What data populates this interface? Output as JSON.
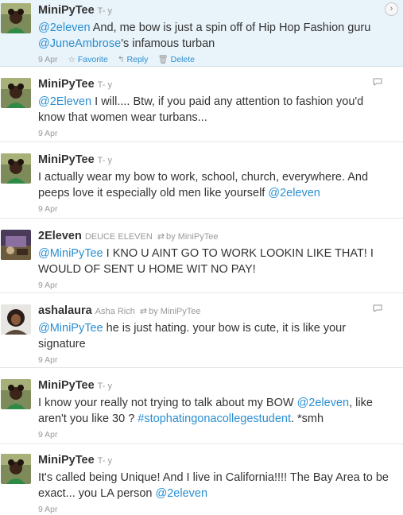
{
  "tweets": [
    {
      "screen_name": "MiniPyTee",
      "full_name": "T- y",
      "text_parts": [
        {
          "t": "@2eleven",
          "k": "mention"
        },
        {
          "t": " And, me bow is just a spin off of Hip Hop Fashion guru ",
          "k": "plain"
        },
        {
          "t": "@JuneAmbrose",
          "k": "mention"
        },
        {
          "t": "'s infamous turban",
          "k": "plain"
        }
      ],
      "date": "9 Apr",
      "actions": {
        "favorite": "Favorite",
        "reply": "Reply",
        "delete": "Delete"
      },
      "expand": "›"
    },
    {
      "screen_name": "MiniPyTee",
      "full_name": "T- y",
      "text_parts": [
        {
          "t": "@2Eleven",
          "k": "mention"
        },
        {
          "t": " I will.... Btw, if you paid any attention to fashion you'd know that women wear turbans...",
          "k": "plain"
        }
      ],
      "date": "9 Apr"
    },
    {
      "screen_name": "MiniPyTee",
      "full_name": "T- y",
      "text_parts": [
        {
          "t": "I actually wear my bow to work, school, church, everywhere. And peeps love it especially old men like yourself ",
          "k": "plain"
        },
        {
          "t": "@2eleven",
          "k": "mention"
        }
      ],
      "date": "9 Apr"
    },
    {
      "screen_name": "2Eleven",
      "full_name": "DEUCE ELEVEN",
      "retweeted_by": "by MiniPyTee",
      "text_parts": [
        {
          "t": "@MiniPyTee",
          "k": "mention"
        },
        {
          "t": " I KNO U AINT GO TO WORK LOOKIN LIKE THAT! I WOULD OF SENT U HOME WIT NO PAY!",
          "k": "plain"
        }
      ],
      "date": "9 Apr"
    },
    {
      "screen_name": "ashalaura",
      "full_name": "Asha Rich",
      "retweeted_by": "by MiniPyTee",
      "text_parts": [
        {
          "t": "@MiniPyTee",
          "k": "mention"
        },
        {
          "t": " he is just hating. your bow is cute, it is like your signature",
          "k": "plain"
        }
      ],
      "date": "9 Apr"
    },
    {
      "screen_name": "MiniPyTee",
      "full_name": "T- y",
      "text_parts": [
        {
          "t": "I know your really not trying to talk about my BOW ",
          "k": "plain"
        },
        {
          "t": "@2eleven",
          "k": "mention"
        },
        {
          "t": ", like aren't you like 30 ? ",
          "k": "plain"
        },
        {
          "t": "#stophatingonacollegestudent",
          "k": "hashtag"
        },
        {
          "t": ". *smh",
          "k": "plain"
        }
      ],
      "date": "9 Apr"
    },
    {
      "screen_name": "MiniPyTee",
      "full_name": "T- y",
      "text_parts": [
        {
          "t": "It's called being Unique! And I live in California!!!! The Bay Area to be exact... you LA person ",
          "k": "plain"
        },
        {
          "t": "@2eleven",
          "k": "mention"
        }
      ],
      "date": "9 Apr"
    }
  ],
  "icons": {
    "favorite": "star-icon",
    "reply": "reply-arrow-icon",
    "delete": "trash-icon",
    "retweet": "retweet-icon",
    "conversation": "speech-bubble-icon"
  },
  "colors": {
    "link": "#2a8fd2",
    "selected_bg": "#e8f3fa",
    "muted": "#999999",
    "text": "#333333"
  }
}
